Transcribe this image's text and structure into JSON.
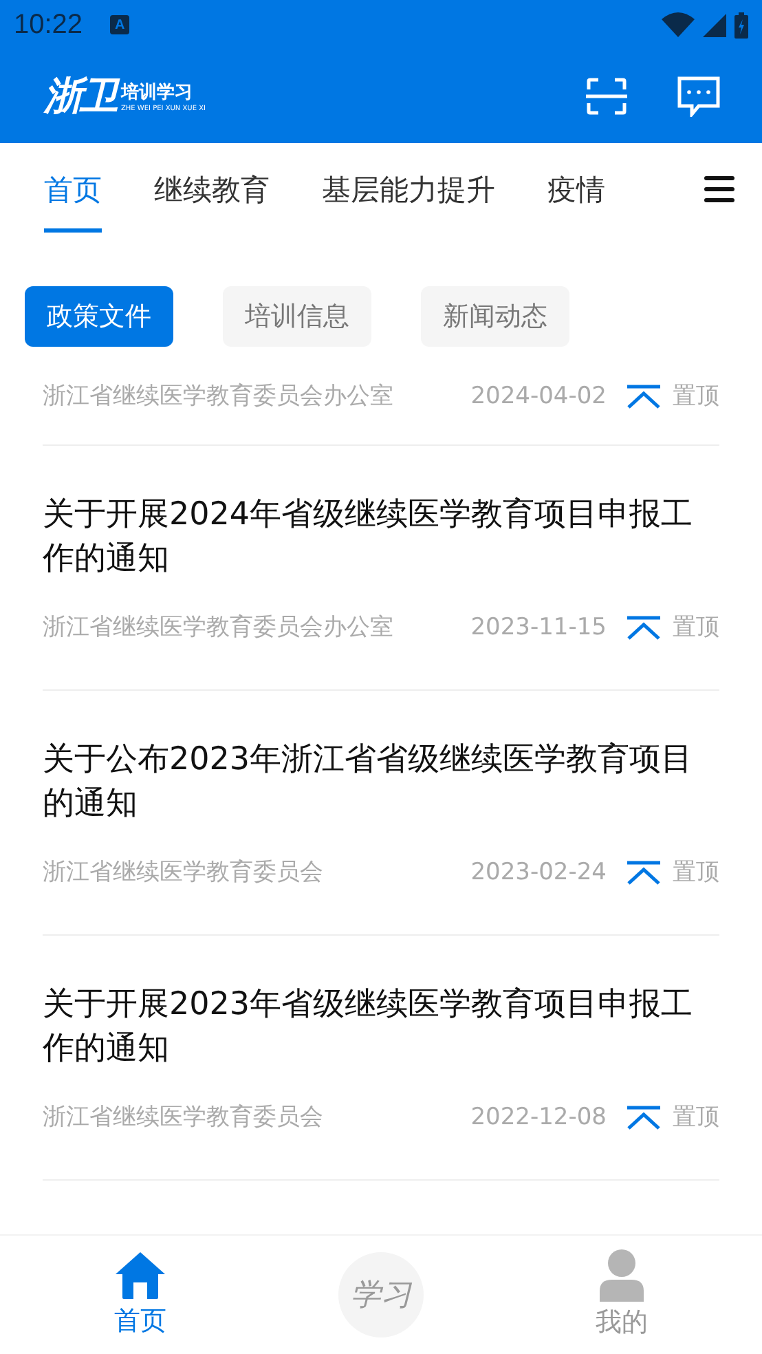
{
  "status_bar": {
    "time": "10:22",
    "notification_icon": "A"
  },
  "app_bar": {
    "logo_text": "浙卫",
    "logo_subtitle": "培训学习",
    "logo_pinyin": "ZHE WEI PEI XUN XUE XI"
  },
  "tabs": [
    {
      "label": "首页",
      "selected": true
    },
    {
      "label": "继续教育",
      "selected": false
    },
    {
      "label": "基层能力提升",
      "selected": false
    },
    {
      "label": "疫情",
      "selected": false
    }
  ],
  "chips": [
    {
      "label": "政策文件",
      "selected": true
    },
    {
      "label": "培训信息",
      "selected": false
    },
    {
      "label": "新闻动态",
      "selected": false
    }
  ],
  "articles": [
    {
      "source": "浙江省继续医学教育委员会办公室",
      "date": "2024-04-02",
      "pinned": true,
      "pin_label": "置顶"
    },
    {
      "title": "关于开展2024年省级继续医学教育项目申报工作的通知",
      "source": "浙江省继续医学教育委员会办公室",
      "date": "2023-11-15",
      "pinned": true,
      "pin_label": "置顶"
    },
    {
      "title": "关于公布2023年浙江省省级继续医学教育项目的通知",
      "source": "浙江省继续医学教育委员会",
      "date": "2023-02-24",
      "pinned": true,
      "pin_label": "置顶"
    },
    {
      "title": "关于开展2023年省级继续医学教育项目申报工作的通知",
      "source": "浙江省继续医学教育委员会",
      "date": "2022-12-08",
      "pinned": true,
      "pin_label": "置顶"
    }
  ],
  "bottom_nav": [
    {
      "kind": "home",
      "label": "首页",
      "selected": true
    },
    {
      "kind": "study",
      "label": "学习",
      "selected": false
    },
    {
      "kind": "profile",
      "label": "我的",
      "selected": false
    }
  ]
}
